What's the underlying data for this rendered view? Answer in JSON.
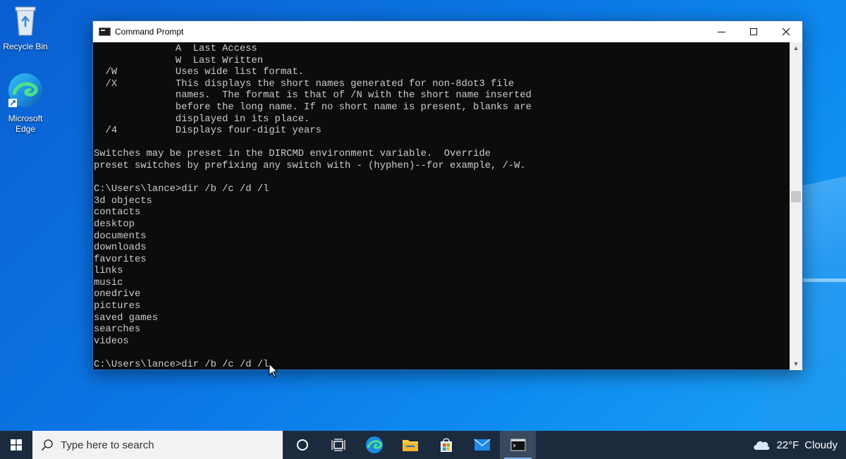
{
  "desktop": {
    "icons": [
      {
        "label": "Recycle Bin",
        "icon": "recycle-bin-icon"
      },
      {
        "label": "Microsoft Edge",
        "icon": "edge-icon"
      }
    ]
  },
  "window": {
    "title": "Command Prompt",
    "console_lines": [
      "              A  Last Access",
      "              W  Last Written",
      "  /W          Uses wide list format.",
      "  /X          This displays the short names generated for non-8dot3 file",
      "              names.  The format is that of /N with the short name inserted",
      "              before the long name. If no short name is present, blanks are",
      "              displayed in its place.",
      "  /4          Displays four-digit years",
      "",
      "Switches may be preset in the DIRCMD environment variable.  Override",
      "preset switches by prefixing any switch with - (hyphen)--for example, /-W.",
      "",
      "C:\\Users\\lance>dir /b /c /d /l",
      "3d objects",
      "contacts",
      "desktop",
      "documents",
      "downloads",
      "favorites",
      "links",
      "music",
      "onedrive",
      "pictures",
      "saved games",
      "searches",
      "videos",
      "",
      "C:\\Users\\lance>dir /b /c /d /l"
    ]
  },
  "taskbar": {
    "search_placeholder": "Type here to search",
    "apps": [
      "cortana-icon",
      "task-view-icon",
      "edge-icon",
      "file-explorer-icon",
      "store-icon",
      "mail-icon",
      "command-prompt-icon"
    ],
    "active_app": "command-prompt-icon",
    "weather": {
      "temp": "22°F",
      "condition": "Cloudy"
    }
  },
  "colors": {
    "desktop": "#0b78e6",
    "taskbar": "#1c2a3d",
    "console_bg": "#0c0c0c",
    "console_text": "#cccccc"
  }
}
